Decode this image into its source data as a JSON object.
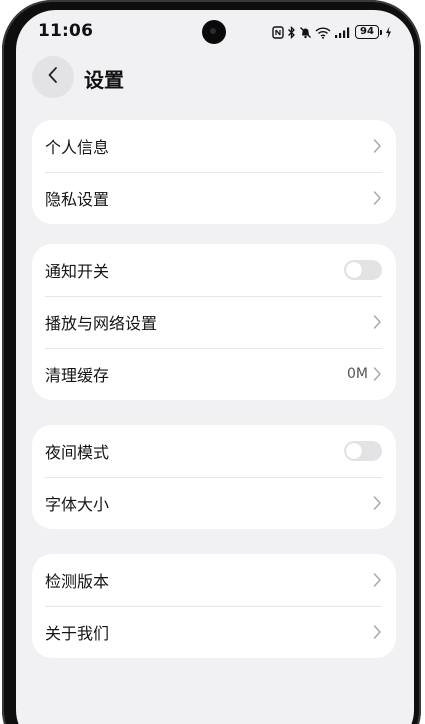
{
  "status_bar": {
    "time": "11:06",
    "battery": "94",
    "icons": [
      "nfc-icon",
      "bluetooth-icon",
      "mute-icon",
      "wifi-icon",
      "signal-icon",
      "battery-icon",
      "charging-icon"
    ]
  },
  "header": {
    "title": "设置",
    "back_icon": "chevron-left-icon"
  },
  "groups": [
    {
      "items": [
        {
          "label": "个人信息",
          "control": "chevron"
        },
        {
          "label": "隐私设置",
          "control": "chevron"
        }
      ]
    },
    {
      "items": [
        {
          "label": "通知开关",
          "control": "toggle",
          "on": false
        },
        {
          "label": "播放与网络设置",
          "control": "chevron"
        },
        {
          "label": "清理缓存",
          "control": "chevron",
          "value": "0M"
        }
      ]
    },
    {
      "items": [
        {
          "label": "夜间模式",
          "control": "toggle",
          "on": false
        },
        {
          "label": "字体大小",
          "control": "chevron"
        }
      ]
    },
    {
      "items": [
        {
          "label": "检测版本",
          "control": "chevron"
        },
        {
          "label": "关于我们",
          "control": "chevron"
        }
      ]
    }
  ],
  "colors": {
    "screen_background": "#f1f1f3",
    "card_background": "#ffffff",
    "toggle_off": "#e3e3e6",
    "text_primary": "#151515"
  }
}
